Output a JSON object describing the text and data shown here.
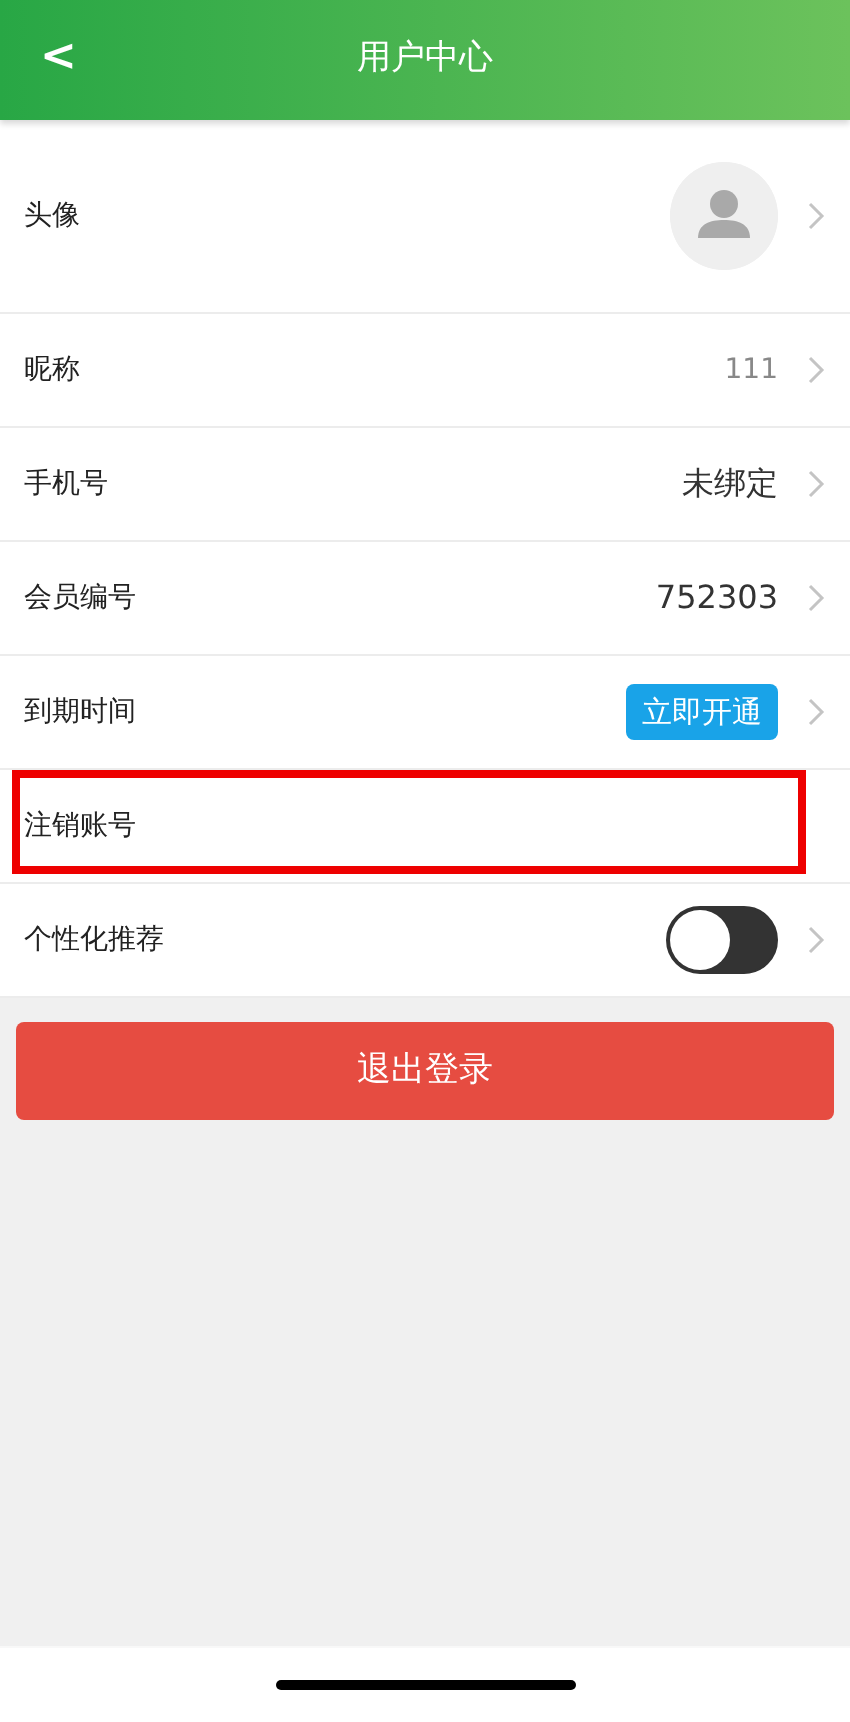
{
  "header": {
    "back": "<",
    "title": "用户中心"
  },
  "rows": [
    {
      "kind": "avatar",
      "label": "头像",
      "chevron": true,
      "highlighted": false
    },
    {
      "kind": "value",
      "label": "昵称",
      "value": "111",
      "chevron": true,
      "highlighted": false
    },
    {
      "kind": "value",
      "label": "手机号",
      "value": "未绑定",
      "chevron": true,
      "highlighted": false
    },
    {
      "kind": "value",
      "label": "会员编号",
      "value": "752303",
      "chevron": true,
      "highlighted": false
    },
    {
      "kind": "button",
      "label": "到期时间",
      "button": "立即开通",
      "chevron": true,
      "highlighted": false
    },
    {
      "kind": "plain",
      "label": "注销账号",
      "chevron": false,
      "highlighted": true
    },
    {
      "kind": "toggle",
      "label": "个性化推荐",
      "on": false,
      "chevron": true,
      "highlighted": false
    }
  ],
  "logout": "退出登录"
}
